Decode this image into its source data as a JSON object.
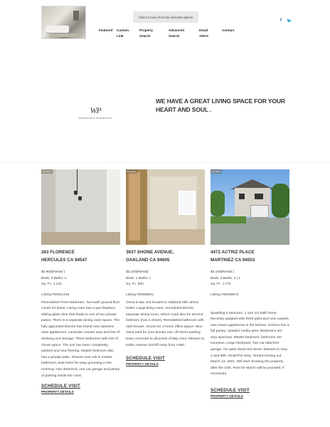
{
  "header": {
    "menu_select_placeholder": "Select a menu from the elements options",
    "social": {
      "facebook": "f",
      "twitter": "🐦"
    },
    "nav": [
      {
        "line1": "Featured",
        "line2": ""
      },
      {
        "line1": "Custom",
        "line2": "Link"
      },
      {
        "line1": "Property",
        "line2": "Search"
      },
      {
        "line1": "Advanced",
        "line2": "Search"
      },
      {
        "line1": "Email",
        "line2": "Alerts"
      },
      {
        "line1": "Contact",
        "line2": ""
      }
    ]
  },
  "banner": {
    "logo_mark": "WP",
    "logo_sub": "WATERFRONT PROPERTIES",
    "tagline": "WE HAVE A GREAT LIVING SPACE FOR YOUR HEART AND SOUL ."
  },
  "listings": [
    {
      "badge": "For Rent",
      "address_line1": "263 FLORENCE",
      "address_line2": "HERCULES CA 94547",
      "price": "$2,900(Rental )",
      "beds_baths": "Beds: 3 Baths: 2",
      "sqft": "Sq. Ft.: 1,141",
      "listing_no": "Listing #40941319",
      "description": "Remodeled Three Bedroom, Two bath ground floor condo for lease. Living room has a gas fireplace, sliding glass door that leads to one of two private patios. There is a separate dining room space. The fully appointed kitchen has brand new stainless steel appliances. Laminate counter tops and lots of shelving and storage. Three bedrooms with lots of closet space. The unit has been completely painted and new flooring. Master bedroom also has a private patio. Shower over tub in master bathroom, dual sinks for easy grooming in the morning. Has detached, one car garage and plenty of parking inside the court.",
      "schedule_label": "SCHEDULE VISIT",
      "details_label": "PROPERTY DETAILS"
    },
    {
      "badge": "For Rent",
      "address_line1": "3637 SHONE AVENUE,",
      "address_line2": "OAKLAND CA 94605",
      "price": "$2,100(Rental)",
      "beds_baths": "Beds: 1 Baths: 1",
      "sqft": "Sq. Ft.: 800",
      "listing_no": "Listing #40939621",
      "description": "Great in law unit located in Oakland Hills above Keller. Large living room, remodeled kitchen, separate dining room, which could also be second bedroom (has a closet). Remodeled bathroom with stall shower. Alcove for a home office space. Nice sized yard for your private use, off street parking. Easy commute to all points of Bay Area. Minutes to Keller Avenue On/Off ramp from I-580.",
      "schedule_label": "SCHEDULE VISIT",
      "details_label": "PROPERTY DETAILS"
    },
    {
      "badge": "For Rent",
      "address_line1": "4472 ACTRIZ PLACE",
      "address_line2": "MARTINEZ CA 94553",
      "price": "$3,100(Rental )",
      "beds_baths": "Beds: 4 Baths: 2 | 1",
      "sqft": "Sq. Ft.: 1,772",
      "listing_no": "Listing #40939673",
      "description": "Sparkling 4 bedroom, 2 and 1/2 bath home. Recently updated with fresh paint and new carpets. Has newer appliances in the kitchen. Kitchen has a full pantry. Upstairs media area. Bedrooms are very spacious. Master bedroom, bathroom are luxurious. Large backyard. Two car attached garage. On quiet dead end street. Minutes to Hwy 4 and 680. Small Pet okay. Tenant moving out March 13, 2021. Will start showing the property after the 15th. Rent for March will be prorated, if necessary.",
      "schedule_label": "SCHEDULE VISIT",
      "details_label": "PROPERTY DETAILS"
    }
  ]
}
